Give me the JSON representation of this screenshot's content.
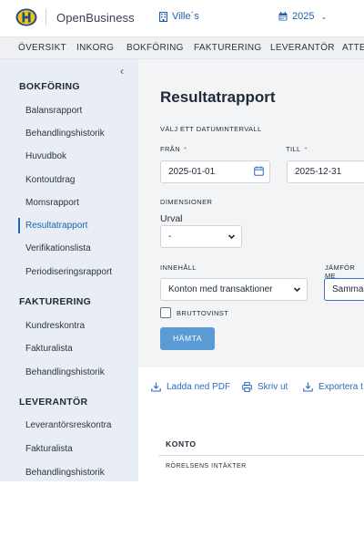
{
  "header": {
    "brand": "OpenBusiness",
    "company": "Ville´s",
    "year": "2025",
    "brand_color": "#1a4a9c",
    "accent_color": "#2060b0"
  },
  "topnav": [
    "ÖVERSIKT",
    "INKORG",
    "BOKFÖRING",
    "FAKTURERING",
    "LEVERANTÖR",
    "ATTES"
  ],
  "sidebar": {
    "sections": [
      {
        "title": "BOKFÖRING",
        "items": [
          "Balansrapport",
          "Behandlingshistorik",
          "Huvudbok",
          "Kontoutdrag",
          "Momsrapport",
          "Resultatrapport",
          "Verifikationslista",
          "Periodiseringsrapport"
        ]
      },
      {
        "title": "FAKTURERING",
        "items": [
          "Kundreskontra",
          "Fakturalista",
          "Behandlingshistorik"
        ]
      },
      {
        "title": "LEVERANTÖR",
        "items": [
          "Leverantörsreskontra",
          "Fakturalista",
          "Behandlingshistorik"
        ]
      }
    ],
    "active_item": "Resultatrapport"
  },
  "main": {
    "title": "Resultatrapport",
    "date_range_label": "VÄLJ ETT DATUMINTERVALL",
    "from_label": "FRÅN",
    "from_value": "2025-01-01",
    "to_label": "TILL",
    "to_value": "2025-12-31",
    "required_mark": "*",
    "dimensions_label": "DIMENSIONER",
    "urval_label": "Urval",
    "urval_value": "-",
    "content_label": "INNEHÅLL",
    "content_value": "Konton med transaktioner",
    "compare_label": "JÄMFÖR ME",
    "compare_value": "Samma",
    "gross_profit_label": "BRUTTOVINST",
    "gross_profit_checked": false,
    "fetch_button": "HÄMTA"
  },
  "results": {
    "actions": [
      "Ladda ned PDF",
      "Skriv ut",
      "Exportera t"
    ],
    "table_header": "KONTO",
    "group_row": "RÖRELSENS INTÄKTER"
  }
}
